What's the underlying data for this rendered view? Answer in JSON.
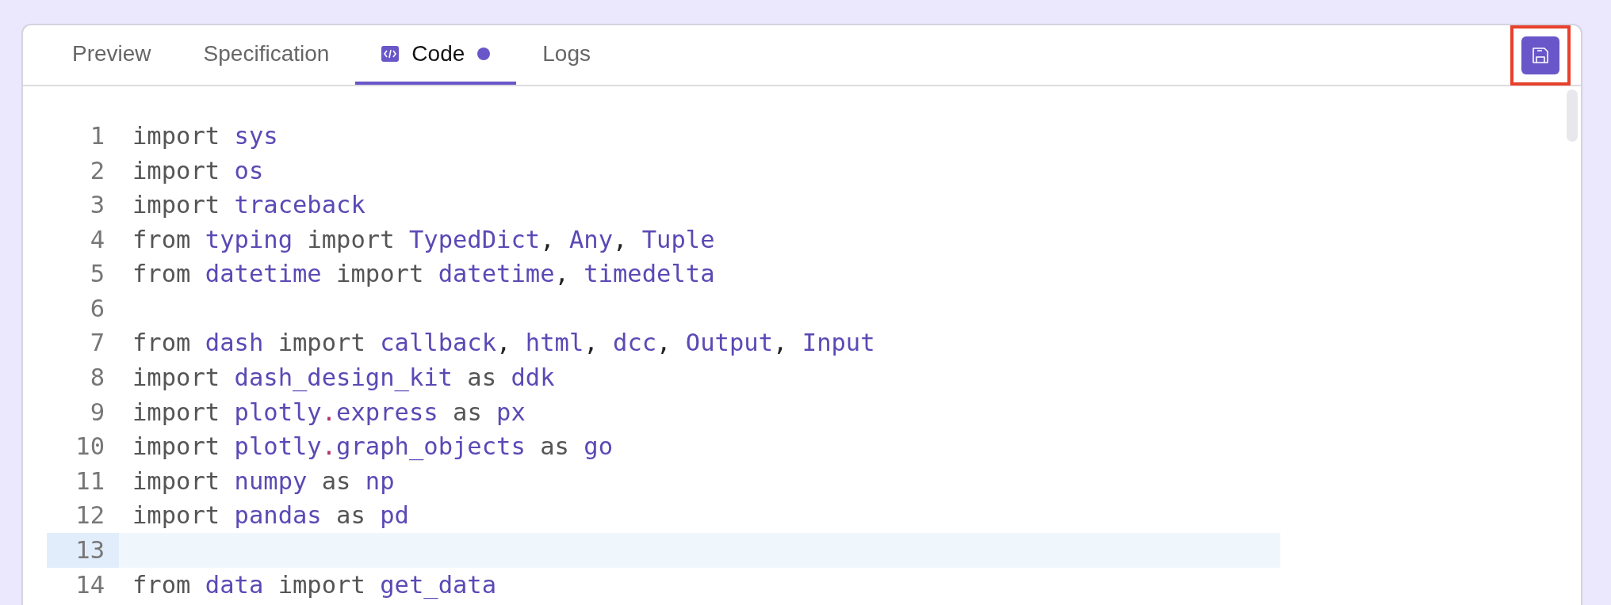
{
  "tabs": [
    {
      "label": "Preview",
      "selected": false,
      "modified": false
    },
    {
      "label": "Specification",
      "selected": false,
      "modified": false
    },
    {
      "label": "Code",
      "selected": true,
      "modified": true,
      "kind": "code"
    },
    {
      "label": "Logs",
      "selected": false,
      "modified": false
    }
  ],
  "save_button": {
    "highlighted": true
  },
  "editor": {
    "lines": [
      {
        "number": "1",
        "current": false,
        "tokens": [
          {
            "kind": "keyword",
            "text": "import "
          },
          {
            "kind": "name",
            "text": "sys"
          }
        ]
      },
      {
        "number": "2",
        "current": false,
        "tokens": [
          {
            "kind": "keyword",
            "text": "import "
          },
          {
            "kind": "name",
            "text": "os"
          }
        ]
      },
      {
        "number": "3",
        "current": false,
        "tokens": [
          {
            "kind": "keyword",
            "text": "import "
          },
          {
            "kind": "name",
            "text": "traceback"
          }
        ]
      },
      {
        "number": "4",
        "current": false,
        "tokens": [
          {
            "kind": "keyword",
            "text": "from "
          },
          {
            "kind": "name",
            "text": "typing"
          },
          {
            "kind": "keyword",
            "text": " import "
          },
          {
            "kind": "name",
            "text": "TypedDict"
          },
          {
            "kind": "punct",
            "text": ", "
          },
          {
            "kind": "name",
            "text": "Any"
          },
          {
            "kind": "punct",
            "text": ", "
          },
          {
            "kind": "name",
            "text": "Tuple"
          }
        ]
      },
      {
        "number": "5",
        "current": false,
        "tokens": [
          {
            "kind": "keyword",
            "text": "from "
          },
          {
            "kind": "name",
            "text": "datetime"
          },
          {
            "kind": "keyword",
            "text": " import "
          },
          {
            "kind": "name",
            "text": "datetime"
          },
          {
            "kind": "punct",
            "text": ", "
          },
          {
            "kind": "name",
            "text": "timedelta"
          }
        ]
      },
      {
        "number": "6",
        "current": false
      },
      {
        "number": "7",
        "current": false,
        "tokens": [
          {
            "kind": "keyword",
            "text": "from "
          },
          {
            "kind": "name",
            "text": "dash"
          },
          {
            "kind": "keyword",
            "text": " import "
          },
          {
            "kind": "name",
            "text": "callback"
          },
          {
            "kind": "punct",
            "text": ", "
          },
          {
            "kind": "name",
            "text": "html"
          },
          {
            "kind": "punct",
            "text": ", "
          },
          {
            "kind": "name",
            "text": "dcc"
          },
          {
            "kind": "punct",
            "text": ", "
          },
          {
            "kind": "name",
            "text": "Output"
          },
          {
            "kind": "punct",
            "text": ", "
          },
          {
            "kind": "name",
            "text": "Input"
          }
        ]
      },
      {
        "number": "8",
        "current": false,
        "tokens": [
          {
            "kind": "keyword",
            "text": "import "
          },
          {
            "kind": "name",
            "text": "dash_design_kit"
          },
          {
            "kind": "keyword",
            "text": " as "
          },
          {
            "kind": "name",
            "text": "ddk"
          }
        ]
      },
      {
        "number": "9",
        "current": false,
        "tokens": [
          {
            "kind": "keyword",
            "text": "import "
          },
          {
            "kind": "name",
            "text": "plotly"
          },
          {
            "kind": "operator",
            "text": "."
          },
          {
            "kind": "name",
            "text": "express"
          },
          {
            "kind": "keyword",
            "text": " as "
          },
          {
            "kind": "name",
            "text": "px"
          }
        ]
      },
      {
        "number": "10",
        "current": false,
        "tokens": [
          {
            "kind": "keyword",
            "text": "import "
          },
          {
            "kind": "name",
            "text": "plotly"
          },
          {
            "kind": "operator",
            "text": "."
          },
          {
            "kind": "name",
            "text": "graph_objects"
          },
          {
            "kind": "keyword",
            "text": " as "
          },
          {
            "kind": "name",
            "text": "go"
          }
        ]
      },
      {
        "number": "11",
        "current": false,
        "tokens": [
          {
            "kind": "keyword",
            "text": "import "
          },
          {
            "kind": "name",
            "text": "numpy"
          },
          {
            "kind": "keyword",
            "text": " as "
          },
          {
            "kind": "name",
            "text": "np"
          }
        ]
      },
      {
        "number": "12",
        "current": false,
        "tokens": [
          {
            "kind": "keyword",
            "text": "import "
          },
          {
            "kind": "name",
            "text": "pandas"
          },
          {
            "kind": "keyword",
            "text": " as "
          },
          {
            "kind": "name",
            "text": "pd"
          }
        ]
      },
      {
        "number": "13",
        "current": true
      },
      {
        "number": "14",
        "current": false,
        "tokens": [
          {
            "kind": "keyword",
            "text": "from "
          },
          {
            "kind": "name",
            "text": "data"
          },
          {
            "kind": "keyword",
            "text": " import "
          },
          {
            "kind": "name",
            "text": "get_data"
          }
        ]
      }
    ]
  }
}
